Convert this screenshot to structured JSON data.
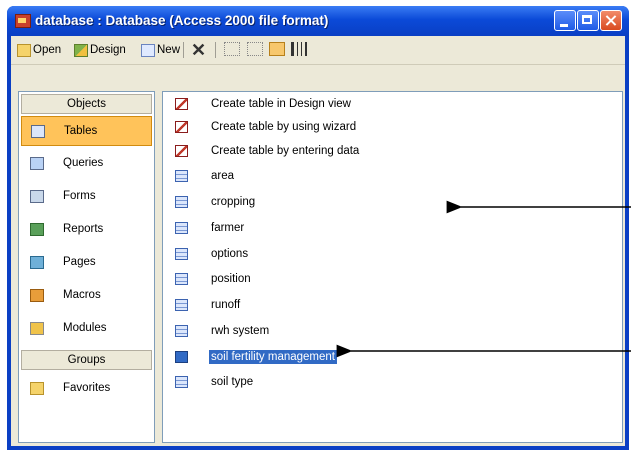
{
  "window": {
    "title": "database : Database (Access 2000 file format)"
  },
  "toolbar": {
    "open_label": "Open",
    "design_label": "Design",
    "new_label": "New",
    "delete_label": "✕"
  },
  "objects": {
    "header": "Objects",
    "items": [
      {
        "label": "Tables",
        "icon": "table-icon",
        "selected": true
      },
      {
        "label": "Queries",
        "icon": "query-icon"
      },
      {
        "label": "Forms",
        "icon": "form-icon"
      },
      {
        "label": "Reports",
        "icon": "report-icon"
      },
      {
        "label": "Pages",
        "icon": "page-icon"
      },
      {
        "label": "Macros",
        "icon": "macro-icon"
      },
      {
        "label": "Modules",
        "icon": "module-icon"
      }
    ],
    "groups_header": "Groups",
    "favorites_label": "Favorites"
  },
  "list": {
    "items": [
      {
        "label": "Create table in Design view",
        "kind": "wizard"
      },
      {
        "label": "Create table by using wizard",
        "kind": "wizard"
      },
      {
        "label": "Create table by entering data",
        "kind": "wizard"
      },
      {
        "label": "area",
        "kind": "table"
      },
      {
        "label": "cropping",
        "kind": "table"
      },
      {
        "label": "farmer",
        "kind": "table"
      },
      {
        "label": "options",
        "kind": "table"
      },
      {
        "label": "position",
        "kind": "table"
      },
      {
        "label": "runoff",
        "kind": "table"
      },
      {
        "label": "rwh system",
        "kind": "table"
      },
      {
        "label": "soil fertility management",
        "kind": "table",
        "selected": true
      },
      {
        "label": "soil type",
        "kind": "table"
      }
    ]
  },
  "colors": {
    "titlebar": "#0a3fc4",
    "selection": "#316ac5",
    "objects_selected": "#ffc35a"
  }
}
